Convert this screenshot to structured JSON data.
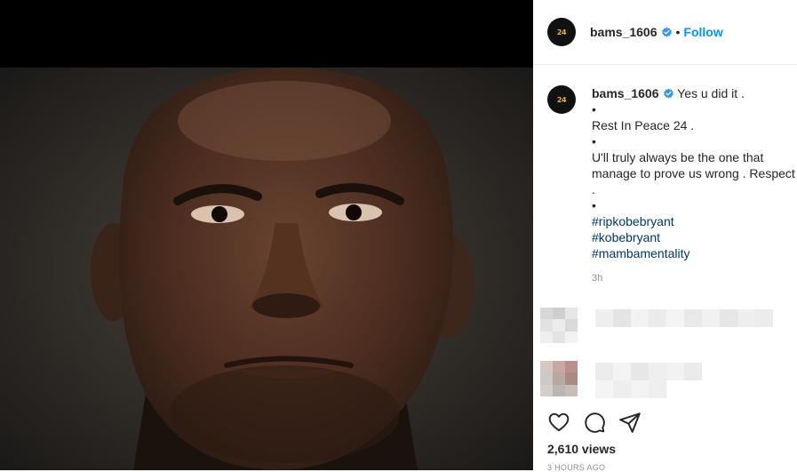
{
  "post": {
    "username": "bams_1606",
    "avatar_text": "24",
    "separator": "•",
    "follow_label": "Follow",
    "caption_lines": [
      "Yes u did it .",
      "•",
      "Rest In Peace 24 .",
      "•",
      "U'll truly always be the one that",
      "manage to prove us wrong . Respect",
      ".",
      "•"
    ],
    "hashtags": [
      "#ripkobebryant",
      "#kobebryant",
      "#mambamentality"
    ],
    "caption_time": "3h",
    "views": "2,610 views",
    "posted_ago": "3 HOURS AGO"
  },
  "icons": {
    "verified": "verified-badge-icon",
    "like": "heart-icon",
    "comment": "comment-icon",
    "share": "share-icon"
  },
  "colors": {
    "accent": "#0095f6",
    "verified": "#3897f0",
    "hashtag": "#00376b",
    "muted": "#8e8e8e"
  }
}
